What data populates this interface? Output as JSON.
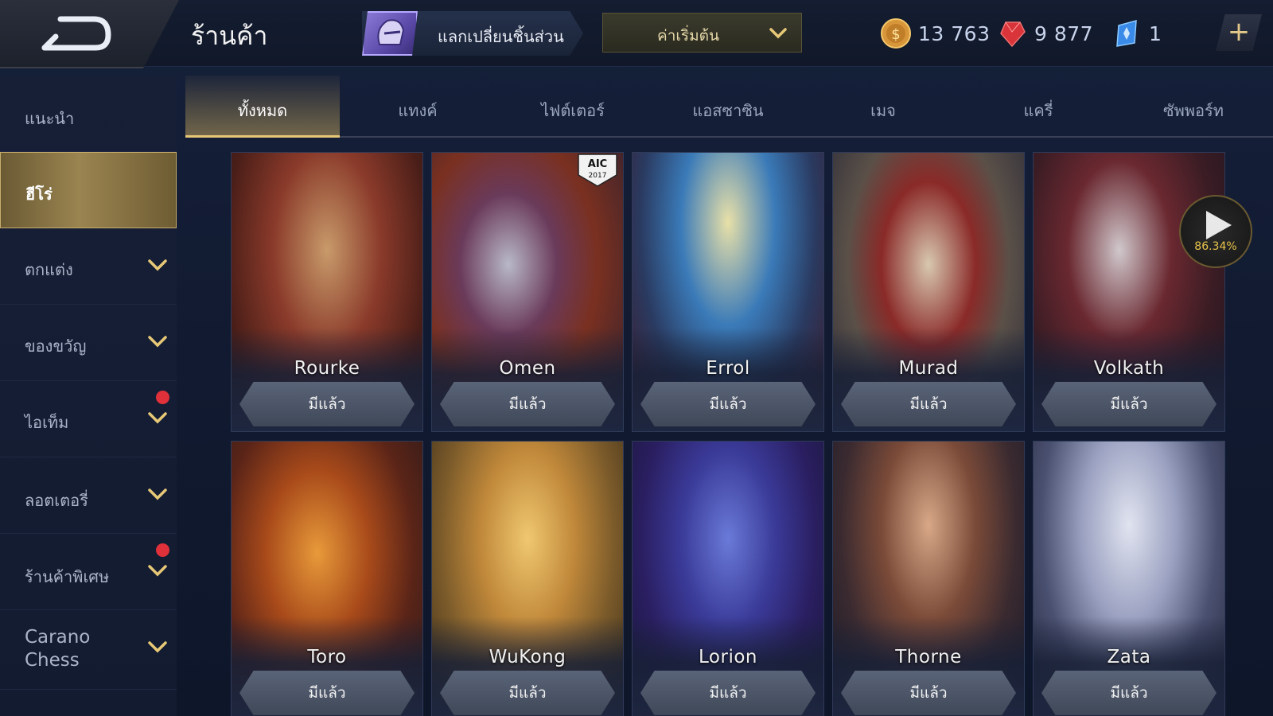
{
  "header": {
    "title": "ร้านค้า",
    "exchange_label": "แลกเปลี่ยนชิ้นส่วน",
    "sort_label": "ค่าเริ่มต้น",
    "currencies": [
      {
        "icon": "gold-coin-icon",
        "value": "13 763"
      },
      {
        "icon": "ruby-icon",
        "value": "9 877"
      },
      {
        "icon": "crystal-voucher-icon",
        "value": "1"
      }
    ],
    "plus_label": "+"
  },
  "sidebar": {
    "items": [
      {
        "label": "แนะนำ"
      },
      {
        "label": "ฮีโร่"
      },
      {
        "label": "ตกแต่ง"
      },
      {
        "label": "ของขวัญ"
      },
      {
        "label": "ไอเท็ม"
      },
      {
        "label": "ลอตเตอรี่"
      },
      {
        "label": "ร้านค้าพิเศษ"
      },
      {
        "label": "Carano Chess"
      }
    ]
  },
  "tabs": [
    "ทั้งหมด",
    "แทงค์",
    "ไฟต์เตอร์",
    "แอสซาซิน",
    "เมจ",
    "แครี่",
    "ซัพพอร์ท"
  ],
  "heroes": [
    {
      "name": "Rourke",
      "status": "มีแล้ว"
    },
    {
      "name": "Omen",
      "status": "มีแล้ว"
    },
    {
      "name": "Errol",
      "status": "มีแล้ว"
    },
    {
      "name": "Murad",
      "status": "มีแล้ว"
    },
    {
      "name": "Volkath",
      "status": "มีแล้ว"
    },
    {
      "name": "Toro",
      "status": "มีแล้ว"
    },
    {
      "name": "WuKong",
      "status": "มีแล้ว"
    },
    {
      "name": "Lorion",
      "status": "มีแล้ว"
    },
    {
      "name": "Thorne",
      "status": "มีแล้ว"
    },
    {
      "name": "Zata",
      "status": "มีแล้ว"
    }
  ],
  "badge_aic": "AIC 2017",
  "play_progress": "86.34%",
  "colors": {
    "accent_gold": "#e7c877",
    "bg": "#131b30",
    "red_dot": "#e0303a"
  }
}
